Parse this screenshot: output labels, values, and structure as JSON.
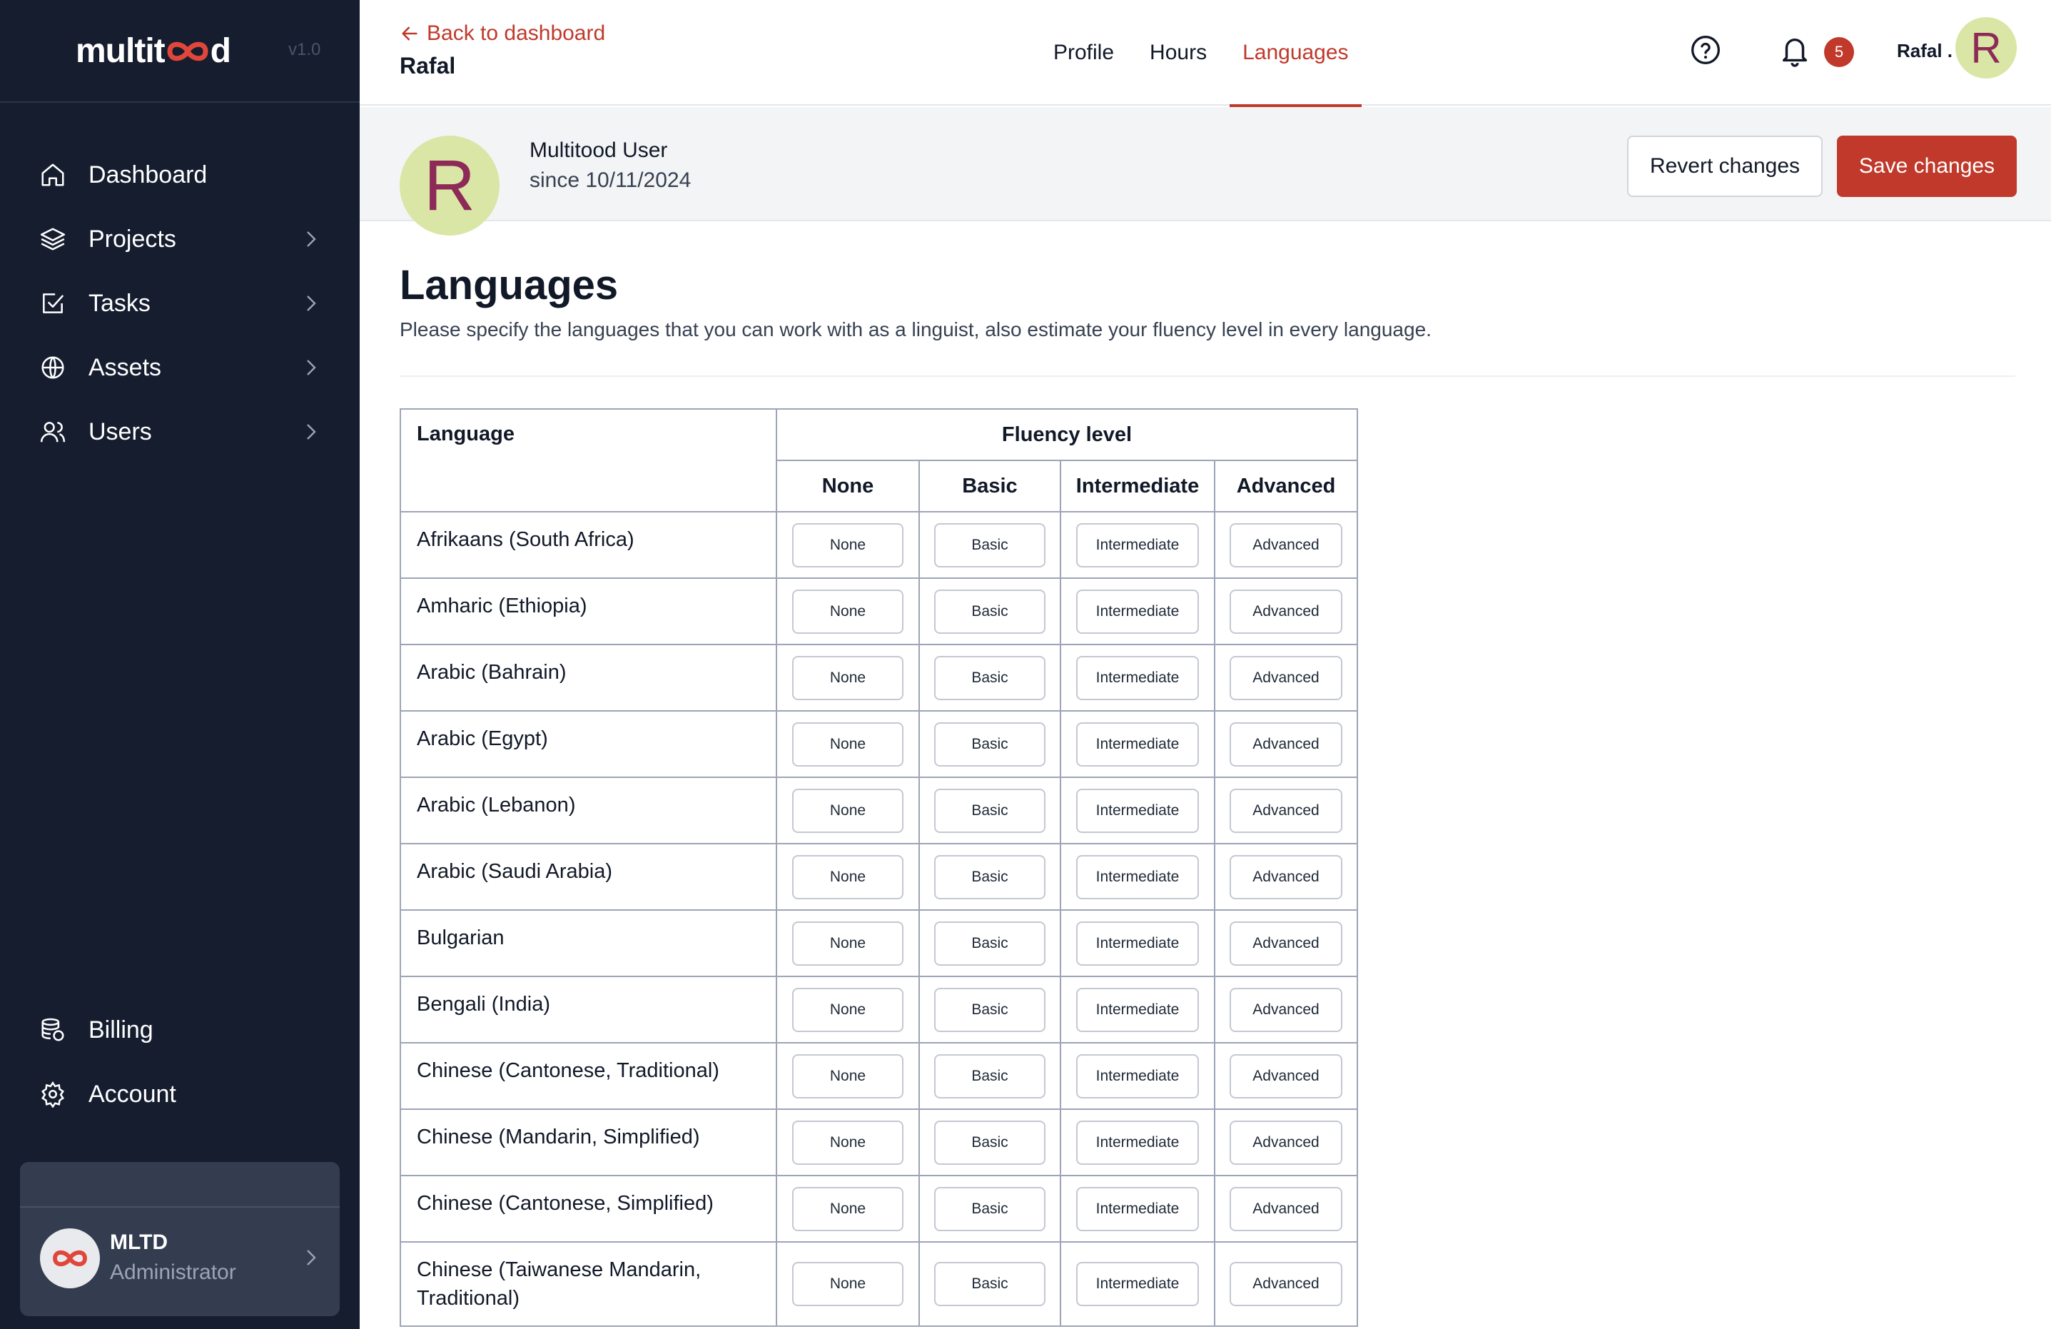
{
  "sidebar": {
    "logo_text_prefix": "multit",
    "logo_text_suffix": "d",
    "version": "v1.0",
    "nav_items": [
      {
        "label": "Dashboard",
        "icon": "home-icon"
      },
      {
        "label": "Projects",
        "icon": "layers-icon"
      },
      {
        "label": "Tasks",
        "icon": "checkbox-icon"
      },
      {
        "label": "Assets",
        "icon": "globe-icon"
      },
      {
        "label": "Users",
        "icon": "users-icon"
      }
    ],
    "bottom_items": [
      {
        "label": "Billing",
        "icon": "billing-icon"
      },
      {
        "label": "Account",
        "icon": "gear-icon"
      }
    ],
    "org": {
      "name": "MLTD",
      "role": "Administrator"
    }
  },
  "header": {
    "back_label": "Back to dashboard",
    "user_title": "Rafal",
    "tabs": [
      {
        "label": "Profile",
        "active": false
      },
      {
        "label": "Hours",
        "active": false
      },
      {
        "label": "Languages",
        "active": true
      }
    ],
    "notification_count": "5",
    "user_name": "Rafal .",
    "avatar_letter": "R"
  },
  "profile": {
    "avatar_letter": "R",
    "name": "Multitood User",
    "since": "since 10/11/2024",
    "revert_label": "Revert changes",
    "save_label": "Save changes"
  },
  "content": {
    "title": "Languages",
    "description": "Please specify the languages that you can work with as a linguist, also estimate your fluency level in every language."
  },
  "table": {
    "header_language": "Language",
    "header_fluency": "Fluency level",
    "levels": [
      "None",
      "Basic",
      "Intermediate",
      "Advanced"
    ],
    "rows": [
      "Afrikaans (South Africa)",
      "Amharic (Ethiopia)",
      "Arabic (Bahrain)",
      "Arabic (Egypt)",
      "Arabic (Lebanon)",
      "Arabic (Saudi Arabia)",
      "Bulgarian",
      "Bengali (India)",
      "Chinese (Cantonese, Traditional)",
      "Chinese (Mandarin, Simplified)",
      "Chinese (Cantonese, Simplified)",
      "Chinese (Taiwanese Mandarin, Traditional)"
    ]
  },
  "colors": {
    "accent": "#c0392b",
    "sidebar_bg": "#151d2f",
    "avatar_bg": "#d9e6a5",
    "avatar_fg": "#8e2a57"
  }
}
